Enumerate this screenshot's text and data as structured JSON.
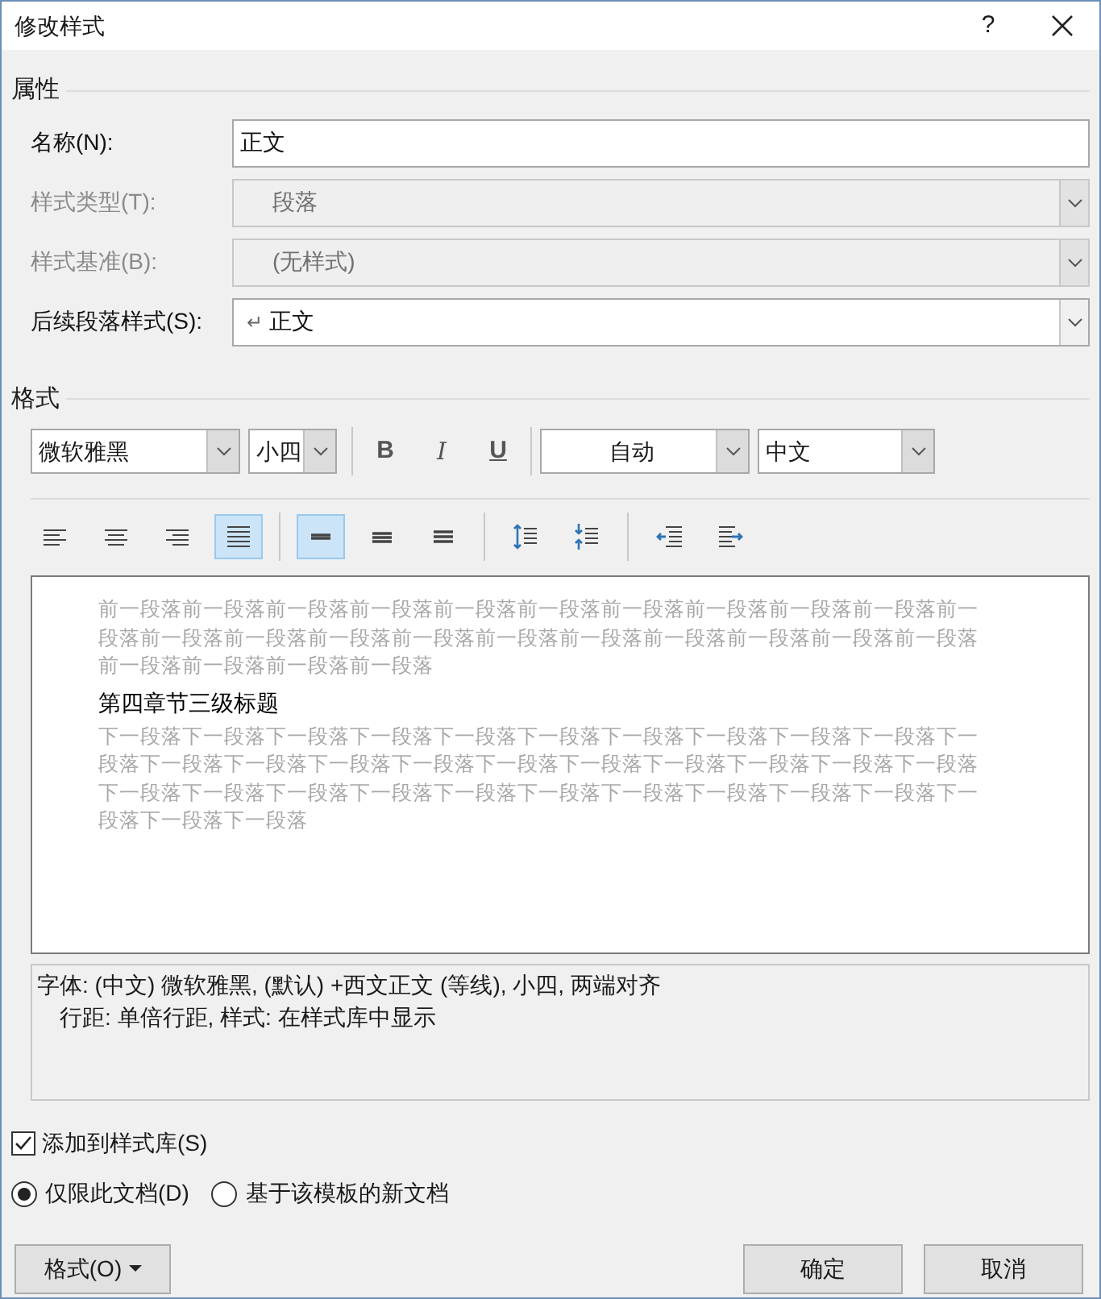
{
  "window": {
    "title": "修改样式",
    "help": "?"
  },
  "properties": {
    "heading": "属性",
    "fields": [
      {
        "label": "名称(N):",
        "value": "正文",
        "kind": "text",
        "disabled": false
      },
      {
        "label": "样式类型(T):",
        "value": "段落",
        "kind": "combo",
        "disabled": true
      },
      {
        "label": "样式基准(B):",
        "value": "(无样式)",
        "kind": "combo",
        "disabled": true
      },
      {
        "label": "后续段落样式(S):",
        "value": "正文",
        "kind": "combo",
        "disabled": false,
        "prefix": "↵"
      }
    ]
  },
  "format": {
    "heading": "格式",
    "font": "微软雅黑",
    "size": "小四",
    "styles": [
      {
        "label": "B",
        "kind": "bold"
      },
      {
        "label": "I",
        "kind": "italic"
      },
      {
        "label": "U",
        "kind": "underline"
      }
    ],
    "color_setting": "自动",
    "language": "中文",
    "toolbar_groups": [
      [
        {
          "kind": "align-left",
          "selected": false
        },
        {
          "kind": "align-center",
          "selected": false
        },
        {
          "kind": "align-right",
          "selected": false
        },
        {
          "kind": "justify",
          "selected": true
        }
      ],
      [
        {
          "kind": "single",
          "selected": true
        },
        {
          "kind": "one-half",
          "selected": false
        },
        {
          "kind": "double",
          "selected": false
        }
      ],
      [
        {
          "kind": "space-increase",
          "selected": false
        },
        {
          "kind": "space-decrease",
          "selected": false
        }
      ],
      [
        {
          "kind": "indent-decrease",
          "selected": false
        },
        {
          "kind": "indent-increase",
          "selected": false
        }
      ]
    ]
  },
  "preview": {
    "before": "前一段落前一段落前一段落前一段落前一段落前一段落前一段落前一段落前一段落前一段落前一段落前一段落前一段落前一段落前一段落前一段落前一段落前一段落前一段落前一段落前一段落前一段落前一段落前一段落前一段落",
    "sample": "第四章节三级标题",
    "after": "下一段落下一段落下一段落下一段落下一段落下一段落下一段落下一段落下一段落下一段落下一段落下一段落下一段落下一段落下一段落下一段落下一段落下一段落下一段落下一段落下一段落下一段落下一段落下一段落下一段落下一段落下一段落下一段落下一段落下一段落下一段落下一段落下一段落下一段落"
  },
  "description": [
    "字体: (中文) 微软雅黑, (默认) +西文正文 (等线), 小四, 两端对齐",
    "行距: 单倍行距, 样式: 在样式库中显示"
  ],
  "add_to_gallery": {
    "label": "添加到样式库(S)",
    "checked": true
  },
  "scope": [
    {
      "label": "仅限此文档(D)",
      "selected": true
    },
    {
      "label": "基于该模板的新文档",
      "selected": false
    }
  ],
  "buttons": {
    "format": "格式(O)",
    "ok": "确定",
    "cancel": "取消"
  }
}
